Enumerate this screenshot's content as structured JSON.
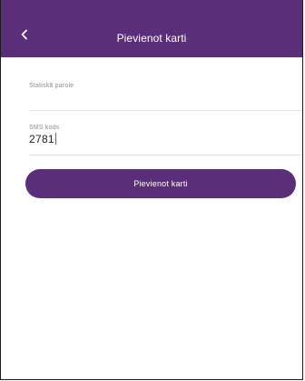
{
  "header": {
    "title": "Pievienot karti",
    "back_icon": "chevron-left-icon",
    "background": "#5b2e7a"
  },
  "form": {
    "password_field": {
      "label": "Statiskā parole",
      "value": ""
    },
    "sms_field": {
      "label": "SMS kods",
      "value": "2781"
    },
    "submit_label": "Pievienot karti"
  },
  "colors": {
    "accent": "#5b2e7a",
    "caret": "#3d6fd6"
  }
}
